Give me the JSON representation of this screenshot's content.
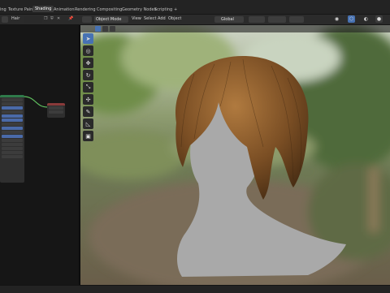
{
  "tabs": [
    {
      "label": "ing",
      "active": false
    },
    {
      "label": "Texture Paint",
      "active": false
    },
    {
      "label": "Shading",
      "active": true
    },
    {
      "label": "Animation",
      "active": false
    },
    {
      "label": "Rendering",
      "active": false
    },
    {
      "label": "Compositing",
      "active": false
    },
    {
      "label": "Geometry Nodes",
      "active": false
    },
    {
      "label": "Scripting",
      "active": false
    },
    {
      "label": "+",
      "active": false
    }
  ],
  "node_editor": {
    "material_name": "Hair"
  },
  "viewport_header": {
    "mode": "Object Mode",
    "menus": [
      "View",
      "Select",
      "Add",
      "Object"
    ],
    "transform_orientation": "Global"
  },
  "tools": [
    {
      "icon": "cursor-select-icon",
      "glyph": "➤",
      "active": true
    },
    {
      "icon": "3d-cursor-icon",
      "glyph": "◎",
      "active": false
    },
    {
      "icon": "move-icon",
      "glyph": "✥",
      "active": false
    },
    {
      "icon": "rotate-icon",
      "glyph": "↻",
      "active": false
    },
    {
      "icon": "scale-icon",
      "glyph": "⤡",
      "active": false
    },
    {
      "icon": "transform-icon",
      "glyph": "✣",
      "active": false
    },
    {
      "icon": "annotate-icon",
      "glyph": "✎",
      "active": false
    },
    {
      "icon": "measure-icon",
      "glyph": "📐",
      "active": false
    },
    {
      "icon": "add-cube-icon",
      "glyph": "▣",
      "active": false
    }
  ],
  "colors": {
    "accent": "#4772b3",
    "node_header_green": "#2f7a4a",
    "node_header_red": "#8a3a3a"
  }
}
